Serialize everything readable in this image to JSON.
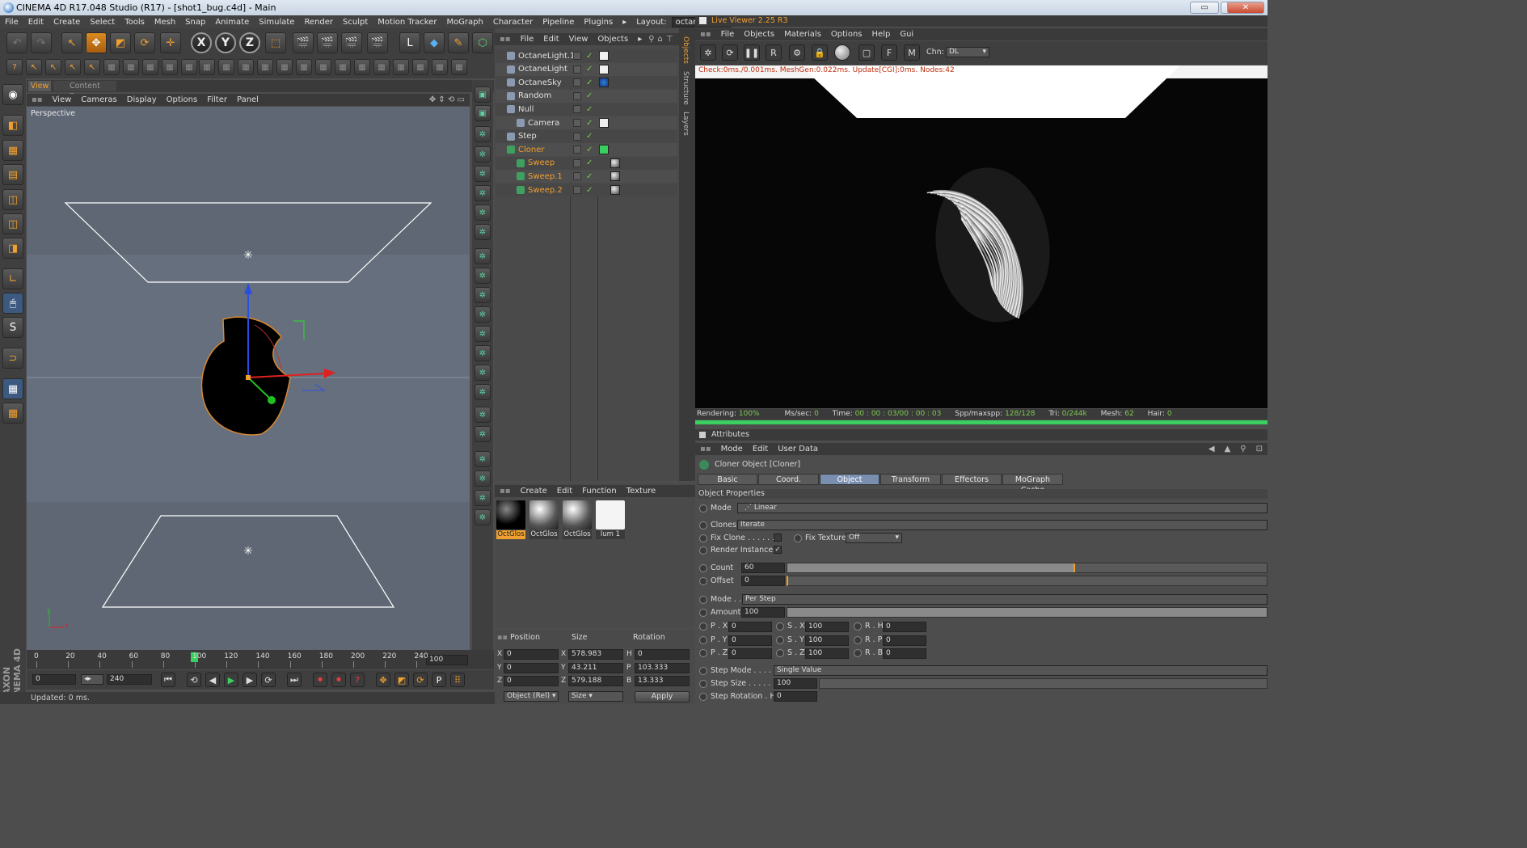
{
  "window": {
    "title": "CINEMA 4D R17.048 Studio (R17) - [shot1_bug.c4d] - Main",
    "min": "▭",
    "restore": "⧉",
    "close": "✕"
  },
  "menu": [
    "File",
    "Edit",
    "Create",
    "Select",
    "Tools",
    "Mesh",
    "Snap",
    "Animate",
    "Simulate",
    "Render",
    "Sculpt",
    "Motion Tracker",
    "MoGraph",
    "Character",
    "Pipeline",
    "Plugins"
  ],
  "layout": {
    "label": "Layout:",
    "value": "octane (User)"
  },
  "viewport": {
    "tabs": [
      "View",
      "Content Browser"
    ],
    "menu": [
      "View",
      "Cameras",
      "Display",
      "Options",
      "Filter",
      "Panel"
    ],
    "label": "Perspective",
    "axis_x": "x",
    "axis_y": "y"
  },
  "brand": {
    "line1": "MAXON",
    "line2": "CINEMA 4D"
  },
  "timeline": {
    "ticks": [
      "0",
      "20",
      "40",
      "60",
      "80",
      "100",
      "120",
      "140",
      "160",
      "180",
      "200",
      "220",
      "240"
    ],
    "end_field": "100",
    "current_frame": "0",
    "min_field": "0",
    "max_field": "240",
    "fps_field": "100",
    "frame_field": "0"
  },
  "status": {
    "text": "Updated: 0 ms."
  },
  "objects": {
    "menu": [
      "File",
      "Edit",
      "View",
      "Objects"
    ],
    "rows": [
      {
        "name": "OctaneLight.1",
        "indent": 0,
        "color": "light"
      },
      {
        "name": "OctaneLight",
        "indent": 0,
        "color": "light"
      },
      {
        "name": "OctaneSky",
        "indent": 0,
        "color": "light"
      },
      {
        "name": "Random",
        "indent": 0,
        "color": "light"
      },
      {
        "name": "Null",
        "indent": 0,
        "color": "light"
      },
      {
        "name": "Camera",
        "indent": 1,
        "color": "light"
      },
      {
        "name": "Step",
        "indent": 0,
        "color": "light"
      },
      {
        "name": "Cloner",
        "indent": 0,
        "color": "orange"
      },
      {
        "name": "Sweep",
        "indent": 1,
        "color": "orange"
      },
      {
        "name": "Sweep.1",
        "indent": 1,
        "color": "orange"
      },
      {
        "name": "Sweep.2",
        "indent": 1,
        "color": "orange"
      }
    ],
    "side_tabs": [
      "Objects",
      "Structure",
      "Layers"
    ]
  },
  "materials": {
    "menu": [
      "Create",
      "Edit",
      "Function",
      "Texture"
    ],
    "items": [
      "OctGlos",
      "OctGlos",
      "OctGlos",
      "lum 1"
    ]
  },
  "coords": {
    "headers": [
      "Position",
      "Size",
      "Rotation"
    ],
    "rows": [
      {
        "a": "X",
        "pos": "0",
        "s": "X",
        "size": "578.983",
        "r": "H",
        "rot": "0"
      },
      {
        "a": "Y",
        "pos": "0",
        "s": "Y",
        "size": "43.211",
        "r": "P",
        "rot": "103.333"
      },
      {
        "a": "Z",
        "pos": "0",
        "s": "Z",
        "size": "579.188",
        "r": "B",
        "rot": "13.333"
      }
    ],
    "mode": "Object (Rel)",
    "size_mode": "Size",
    "apply": "Apply"
  },
  "live_viewer": {
    "title": "Live Viewer 2.25 R3",
    "menu": [
      "File",
      "Objects",
      "Materials",
      "Options",
      "Help",
      "Gui"
    ],
    "chn_label": "Chn:",
    "chn_value": "DL",
    "info": "Check:0ms./0.001ms. MeshGen:0.022ms. Update[CGI]:0ms. Nodes:42",
    "status": {
      "rendering_label": "Rendering:",
      "rendering": "100%",
      "mssec_label": "Ms/sec:",
      "mssec": "0",
      "time_label": "Time:",
      "time": "00 : 00 : 03/00 : 00 : 03",
      "spp_label": "Spp/maxspp:",
      "spp": "128/128",
      "tri_label": "Tri:",
      "tri": "0/244k",
      "mesh_label": "Mesh:",
      "mesh": "62",
      "hair_label": "Hair:",
      "hair": "0"
    }
  },
  "attributes": {
    "title": "Attributes",
    "menu": [
      "Mode",
      "Edit",
      "User Data"
    ],
    "object_title": "Cloner Object [Cloner]",
    "tabs": [
      "Basic",
      "Coord.",
      "Object",
      "Transform",
      "Effectors",
      "MoGraph Cache"
    ],
    "section": "Object Properties",
    "mode_label": "Mode",
    "mode_value": "Linear",
    "clones_label": "Clones",
    "clones_value": "Iterate",
    "fix_clone_label": "Fix Clone . . . . . .",
    "fix_texture_label": "Fix Texture",
    "fix_texture_value": "Off",
    "render_instances_label": "Render Instances",
    "count_label": "Count",
    "count_value": "60",
    "count_fraction": 0.6,
    "offset_label": "Offset",
    "offset_value": "0",
    "mode2_label": "Mode . .",
    "mode2_value": "Per Step",
    "amount_label": "Amount",
    "amount_value": "100",
    "px_label": "P . X",
    "px": "0",
    "sx_label": "S . X",
    "sx": "100",
    "rh_label": "R . H",
    "rh": "0",
    "py_label": "P . Y",
    "py": "0",
    "sy_label": "S . Y",
    "sy": "100",
    "rp_label": "R . P",
    "rp": "0",
    "pz_label": "P . Z",
    "pz": "0",
    "sz_label": "S . Z",
    "sz": "100",
    "rb_label": "R . B",
    "rb": "0",
    "step_mode_label": "Step Mode . . . . .",
    "step_mode_value": "Single Value",
    "step_size_label": "Step Size . . . . . .",
    "step_size_value": "100",
    "step_rotation_label": "Step Rotation . H",
    "step_rotation_value": "0"
  }
}
